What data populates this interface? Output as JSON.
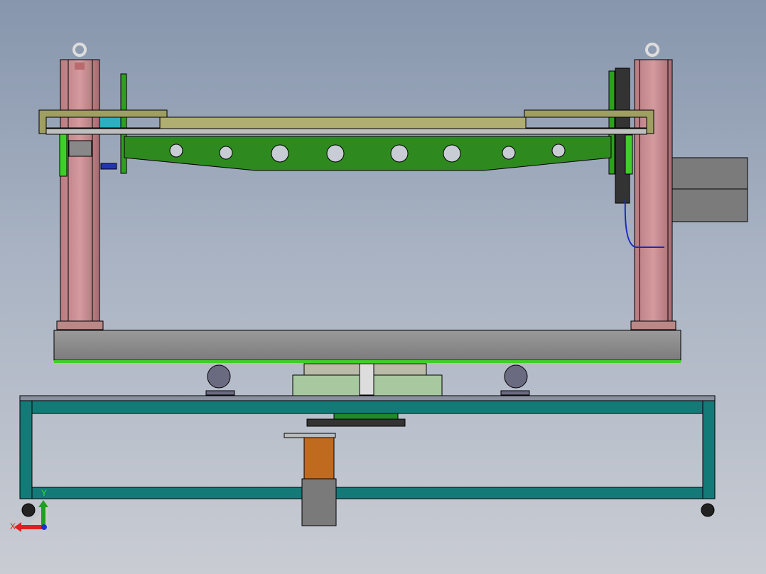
{
  "triad": {
    "x_label": "X",
    "y_label": "Y"
  },
  "colors": {
    "column": "#c98a8e",
    "beam": "#9f9f62",
    "green_frame": "#2e8a1e",
    "base": "#8a8a8a",
    "table_frame": "#147a78",
    "motor": "#7a7a7a",
    "gearbox": "#c06a20"
  }
}
